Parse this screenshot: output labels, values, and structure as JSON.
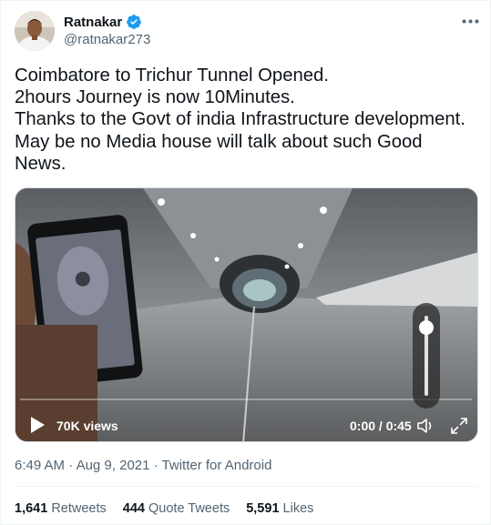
{
  "user": {
    "display_name": "Ratnakar",
    "handle": "@ratnakar273",
    "verified": true
  },
  "tweet": {
    "lines": [
      "Coimbatore to Trichur Tunnel Opened.",
      "2hours Journey is now 10Minutes.",
      "Thanks to the Govt of india Infrastructure development.",
      "May be no Media house will talk about such Good",
      "News."
    ]
  },
  "video": {
    "views": "70K views",
    "time": "0:00 / 0:45",
    "progress": 0,
    "volume_level": 0.9
  },
  "meta": {
    "time": "6:49 AM",
    "date": "Aug 9, 2021",
    "source": "Twitter for Android",
    "separator": "·"
  },
  "stats": {
    "retweets_count": "1,641",
    "retweets_label": "Retweets",
    "quote_count": "444",
    "quote_label": "Quote Tweets",
    "likes_count": "5,591",
    "likes_label": "Likes"
  },
  "colors": {
    "verified": "#1d9bf0",
    "secondary_text": "#536471",
    "primary_text": "#0f1419"
  },
  "icons": [
    "verified-badge-icon",
    "more-icon",
    "play-icon",
    "volume-icon",
    "fullscreen-icon"
  ]
}
